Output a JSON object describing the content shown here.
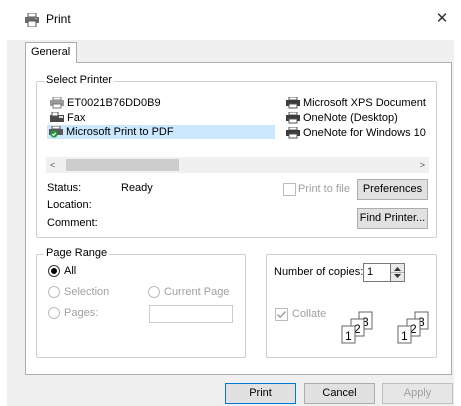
{
  "window": {
    "title": "Print",
    "close_glyph": "✕",
    "title_icon": "printer-icon"
  },
  "tabs": [
    {
      "label": "General"
    }
  ],
  "select_printer": {
    "group_label": "Select Printer",
    "printers": [
      {
        "name": "ET0021B76DD0B9",
        "icon": "network-printer-icon"
      },
      {
        "name": "Fax",
        "icon": "fax-icon"
      },
      {
        "name": "Microsoft Print to PDF",
        "icon": "default-printer-icon",
        "selected": true
      },
      {
        "name": "Microsoft XPS Document Writer",
        "icon": "printer-icon"
      },
      {
        "name": "OneNote (Desktop)",
        "icon": "printer-icon"
      },
      {
        "name": "OneNote for Windows 10",
        "icon": "printer-icon"
      }
    ],
    "scroll_left": "<",
    "scroll_right": ">",
    "status_label": "Status:",
    "status_value": "Ready",
    "location_label": "Location:",
    "comment_label": "Comment:",
    "print_to_file_label": "Print to file",
    "preferences_button": "Preferences",
    "find_printer_button": "Find Printer..."
  },
  "page_range": {
    "group_label": "Page Range",
    "all_label": "All",
    "selection_label": "Selection",
    "current_page_label": "Current Page",
    "pages_label": "Pages:",
    "pages_value": ""
  },
  "copies": {
    "number_label": "Number of copies:",
    "number_value": "1",
    "collate_label": "Collate",
    "collate_checked": true
  },
  "footer": {
    "print_button": "Print",
    "cancel_button": "Cancel",
    "apply_button": "Apply"
  }
}
